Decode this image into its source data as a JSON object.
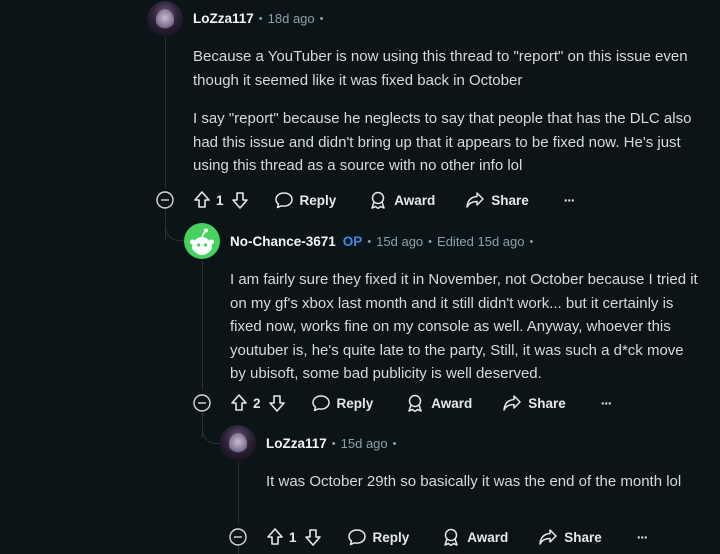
{
  "comments": [
    {
      "author": "LoZza117",
      "op": "",
      "time": "18d ago",
      "edited": "",
      "paragraphs": [
        "Because a YouTuber is now using this thread to \"report\" on this issue even though it seemed like it was fixed back in October",
        "I say \"report\" because he neglects to say that people that has the DLC also had this issue and didn't bring up that it appears to be fixed now. He's just using this thread as a source with no other info lol"
      ],
      "votes": "1"
    },
    {
      "author": "No-Chance-3671",
      "op": "OP",
      "time": "15d ago",
      "edited": "Edited 15d ago",
      "paragraphs": [
        "I am fairly sure they fixed it in November, not October because I tried it on my gf's xbox last month and it still didn't work... but it certainly is fixed now, works fine on my console as well. Anyway, whoever this youtuber is, he's quite late to the party, Still, it was such a d*ck move by ubisoft, some bad publicity is well deserved."
      ],
      "votes": "2"
    },
    {
      "author": "LoZza117",
      "op": "",
      "time": "15d ago",
      "edited": "",
      "paragraphs": [
        "It was October 29th so basically it was the end of the month lol"
      ],
      "votes": "1"
    }
  ],
  "actions": {
    "reply": "Reply",
    "award": "Award",
    "share": "Share",
    "more": "···"
  },
  "colors": {
    "background": "#0b1416",
    "text": "#d7dadc",
    "meta": "#8ba2ad",
    "op": "#3f8ae2",
    "snoo_avatar": "#46d160"
  }
}
